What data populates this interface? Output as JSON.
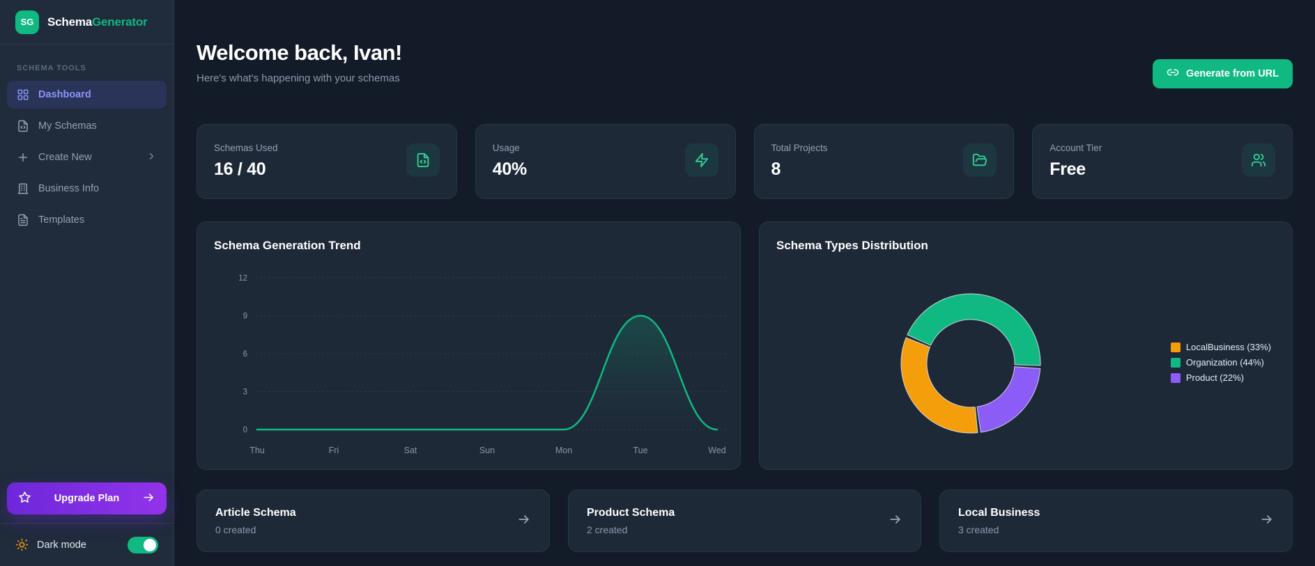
{
  "app": {
    "logo_initials": "SG",
    "brand_schema": "Schema",
    "brand_generator": "Generator"
  },
  "colors": {
    "accent_green": "#10b981",
    "active_nav": "#8b93f8",
    "upgrade_gradient_start": "#6d28d9",
    "upgrade_gradient_end": "#9333ea",
    "orange": "#f59e0b",
    "purple": "#8b5cf6"
  },
  "sidebar": {
    "section_label": "SCHEMA TOOLS",
    "items": [
      {
        "label": "Dashboard",
        "icon": "dashboard-grid",
        "active": true,
        "chevron": false
      },
      {
        "label": "My Schemas",
        "icon": "file-code",
        "active": false,
        "chevron": false
      },
      {
        "label": "Create New",
        "icon": "plus",
        "active": false,
        "chevron": true
      },
      {
        "label": "Business Info",
        "icon": "building",
        "active": false,
        "chevron": false
      },
      {
        "label": "Templates",
        "icon": "file-text",
        "active": false,
        "chevron": false
      }
    ],
    "upgrade": {
      "label": "Upgrade Plan",
      "icon": "star",
      "trailing_icon": "arrow-right"
    },
    "dark_mode": {
      "label": "Dark mode",
      "icon": "sun",
      "enabled": true
    }
  },
  "header": {
    "title": "Welcome back, Ivan!",
    "subtitle": "Here's what's happening with your schemas",
    "cta": {
      "label": "Generate from URL",
      "icon": "link"
    }
  },
  "stats": [
    {
      "label": "Schemas Used",
      "value": "16 / 40",
      "icon": "file-code"
    },
    {
      "label": "Usage",
      "value": "40%",
      "icon": "zap"
    },
    {
      "label": "Total Projects",
      "value": "8",
      "icon": "folder-open"
    },
    {
      "label": "Account Tier",
      "value": "Free",
      "icon": "users"
    }
  ],
  "chart_data": [
    {
      "type": "area",
      "title": "Schema Generation Trend",
      "categories": [
        "Thu",
        "Fri",
        "Sat",
        "Sun",
        "Mon",
        "Tue",
        "Wed"
      ],
      "values": [
        0,
        0,
        0,
        0,
        0,
        9,
        0
      ],
      "xlabel": "",
      "ylabel": "",
      "ylim": [
        0,
        12
      ],
      "yticks": [
        0,
        3,
        6,
        9,
        12
      ],
      "grid": "dashed horizontal",
      "legend_position": "none",
      "line_color": "#10b981"
    },
    {
      "type": "donut",
      "title": "Schema Types Distribution",
      "segments": [
        {
          "label": "LocalBusiness",
          "pct": 33,
          "color": "#f59e0b",
          "legend_label": "LocalBusiness (33%)"
        },
        {
          "label": "Organization",
          "pct": 44,
          "color": "#10b981",
          "legend_label": "Organization (44%)"
        },
        {
          "label": "Product",
          "pct": 22,
          "color": "#8b5cf6",
          "legend_label": "Product (22%)"
        }
      ],
      "start_angle_deg": 173,
      "direction": "clockwise",
      "inner_radius_ratio": 0.63,
      "legend_position": "right"
    }
  ],
  "quick_cards": [
    {
      "title": "Article Schema",
      "subtitle": "0 created"
    },
    {
      "title": "Product Schema",
      "subtitle": "2 created"
    },
    {
      "title": "Local Business",
      "subtitle": "3 created"
    }
  ]
}
